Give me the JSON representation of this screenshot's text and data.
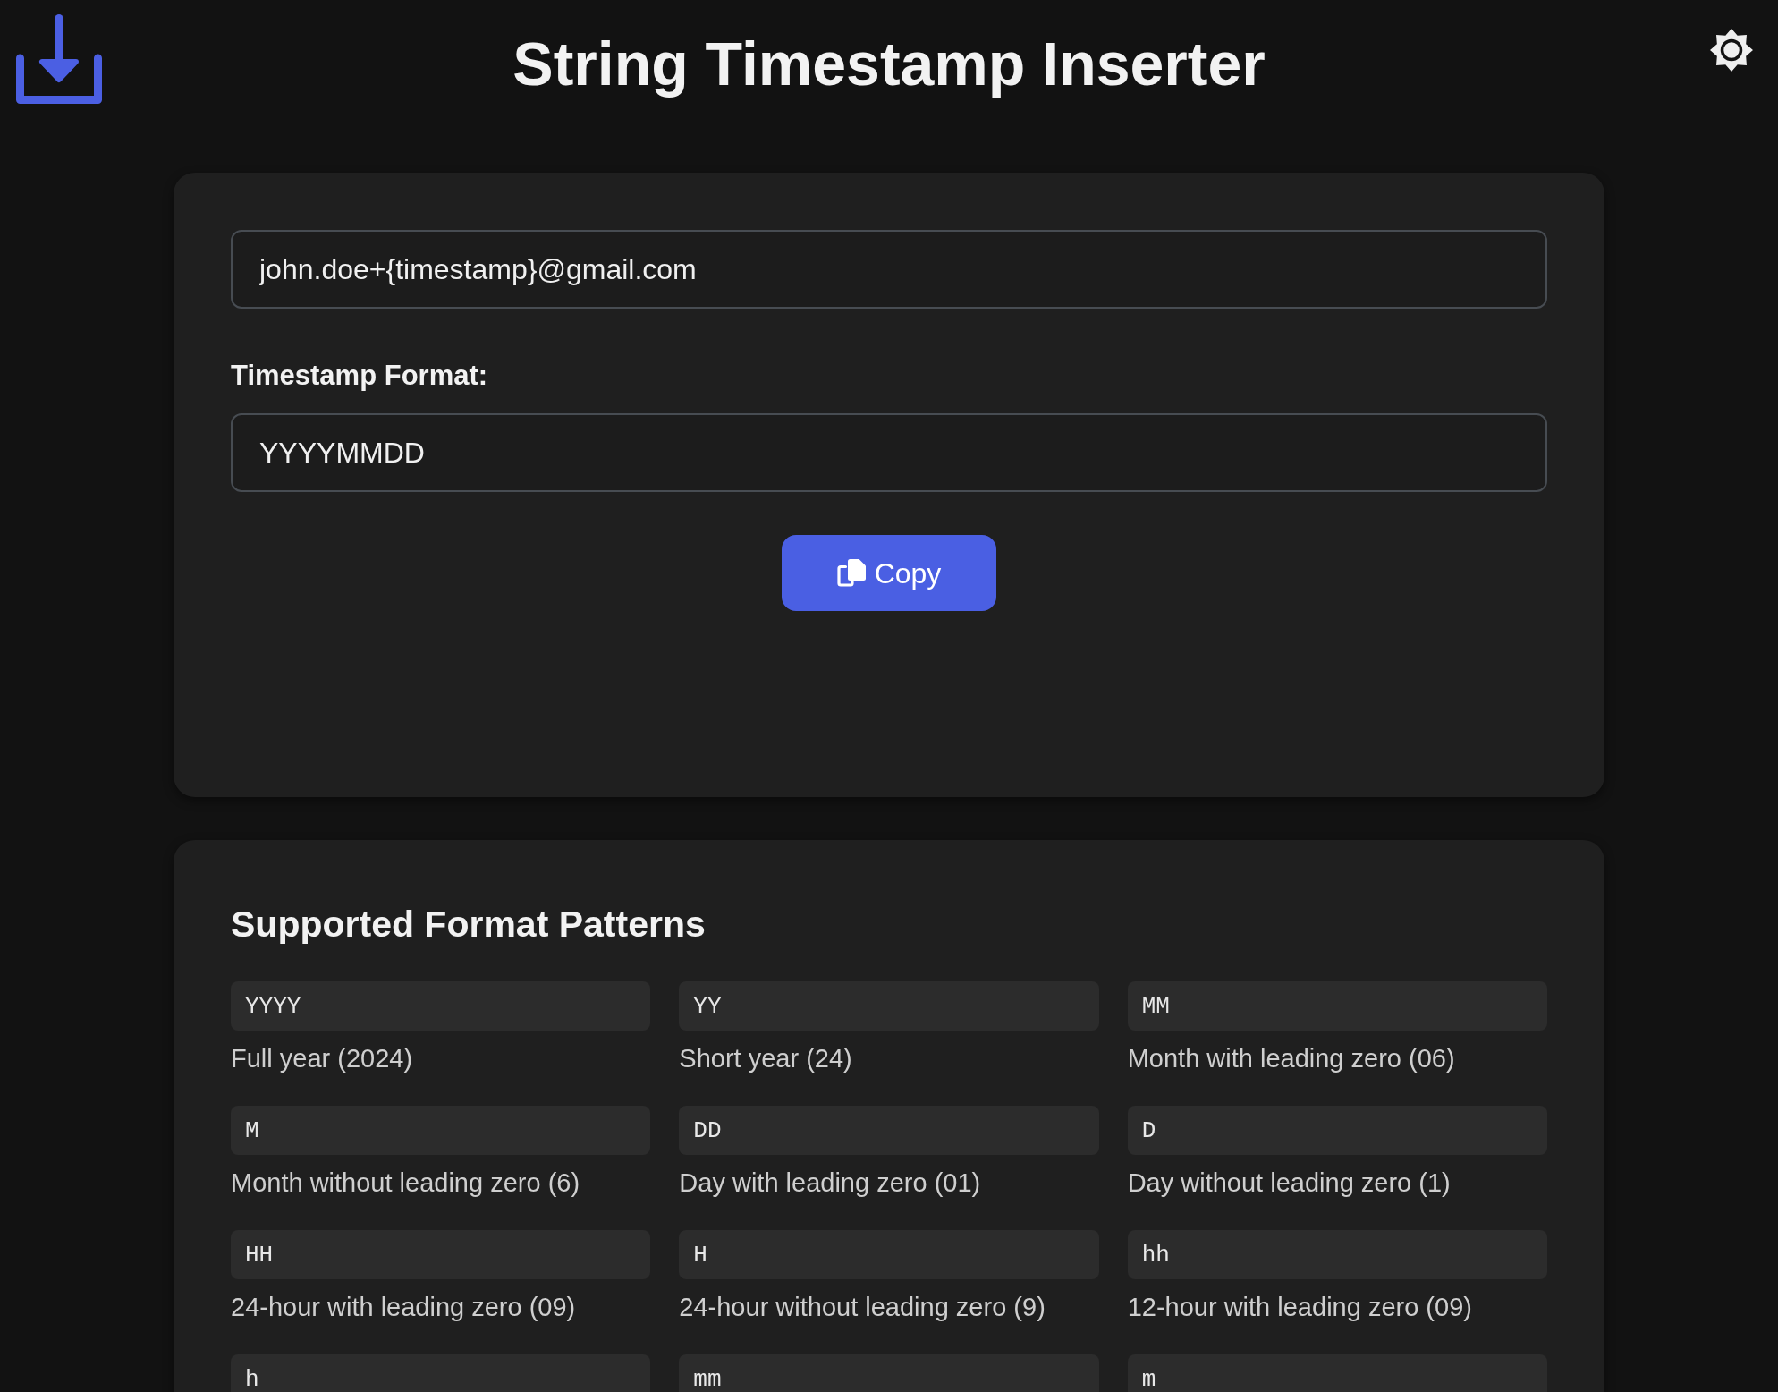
{
  "header": {
    "title": "String Timestamp Inserter"
  },
  "template_field": {
    "value": "john.doe+{timestamp}@gmail.com"
  },
  "format_field": {
    "label": "Timestamp Format:",
    "value": "YYYYMMDD"
  },
  "copy_button": {
    "label": "Copy"
  },
  "patterns": {
    "title": "Supported Format Patterns",
    "items": [
      {
        "code": "YYYY",
        "description": "Full year (2024)"
      },
      {
        "code": "YY",
        "description": "Short year (24)"
      },
      {
        "code": "MM",
        "description": "Month with leading zero (06)"
      },
      {
        "code": "M",
        "description": "Month without leading zero (6)"
      },
      {
        "code": "DD",
        "description": "Day with leading zero (01)"
      },
      {
        "code": "D",
        "description": "Day without leading zero (1)"
      },
      {
        "code": "HH",
        "description": "24-hour with leading zero (09)"
      },
      {
        "code": "H",
        "description": "24-hour without leading zero (9)"
      },
      {
        "code": "hh",
        "description": "12-hour with leading zero (09)"
      },
      {
        "code": "h"
      },
      {
        "code": "mm"
      },
      {
        "code": "m"
      }
    ]
  }
}
